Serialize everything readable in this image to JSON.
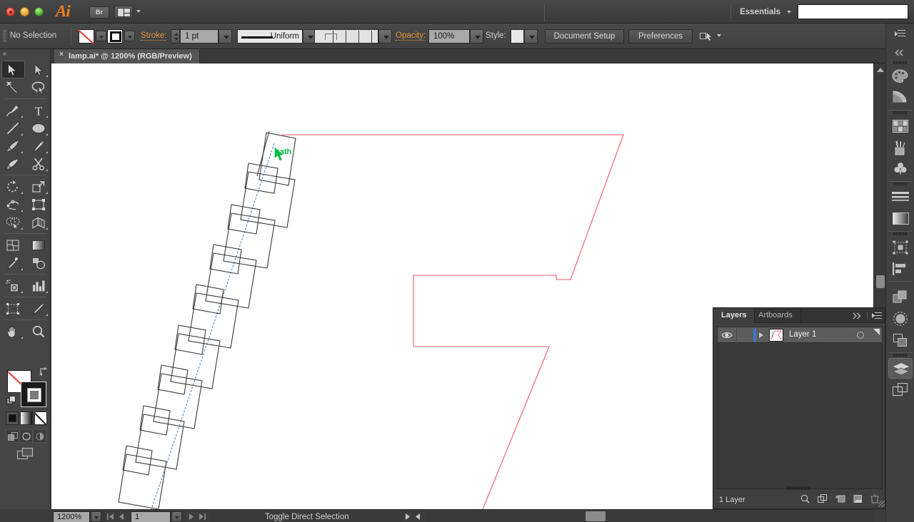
{
  "app": {
    "name": "Adobe Illustrator",
    "logo_text": "Ai",
    "bridge_label": "Br",
    "arrange_docs_name": "arrange-documents",
    "workspace": "Essentials",
    "search_placeholder": ""
  },
  "window_controls": [
    {
      "name": "close",
      "color": "#d93d2e"
    },
    {
      "name": "minimize",
      "color": "#e0a02a"
    },
    {
      "name": "zoom",
      "color": "#49a62a"
    }
  ],
  "control_bar": {
    "selection_status": "No Selection",
    "fill_label": "Fill",
    "fill_value": "None",
    "stroke_swatch_label": "Stroke color",
    "stroke_label": "Stroke:",
    "stroke_weight": "1 pt",
    "profile_label": "Uniform",
    "variable_width_label": "Variable Width Profile",
    "opacity_label": "Opacity:",
    "opacity_value": "100%",
    "style_label": "Style:",
    "document_setup": "Document Setup",
    "preferences": "Preferences",
    "snap_icon": "snap-to-grid-icon"
  },
  "document_tab": {
    "title": "lamp.ai* @ 1200% (RGB/Preview)",
    "close_label": "×"
  },
  "tools": {
    "rows": [
      [
        {
          "label": "Selection Tool",
          "icon": "selection-arrow-icon",
          "selected": true,
          "has_flyout": false
        },
        {
          "label": "Direct Selection Tool",
          "icon": "direct-selection-arrow-icon",
          "selected": false,
          "has_flyout": true
        }
      ],
      [
        {
          "label": "Magic Wand Tool",
          "icon": "magic-wand-icon",
          "selected": false,
          "has_flyout": false
        },
        {
          "label": "Lasso Tool",
          "icon": "lasso-icon",
          "selected": false,
          "has_flyout": false
        }
      ],
      [
        {
          "label": "Pen Tool",
          "icon": "pen-icon",
          "selected": false,
          "has_flyout": true
        },
        {
          "label": "Type Tool",
          "icon": "type-icon",
          "selected": false,
          "has_flyout": true
        }
      ],
      [
        {
          "label": "Line Segment Tool",
          "icon": "line-segment-icon",
          "selected": false,
          "has_flyout": true
        },
        {
          "label": "Ellipse Tool",
          "icon": "ellipse-icon",
          "selected": false,
          "has_flyout": true
        }
      ],
      [
        {
          "label": "Paintbrush Tool",
          "icon": "paintbrush-icon",
          "selected": false,
          "has_flyout": true
        },
        {
          "label": "Pencil Tool",
          "icon": "pencil-icon",
          "selected": false,
          "has_flyout": true
        }
      ],
      [
        {
          "label": "Blob Brush Tool",
          "icon": "blob-brush-icon",
          "selected": false,
          "has_flyout": false
        },
        {
          "label": "Eraser Tool",
          "icon": "scissors-icon",
          "selected": false,
          "has_flyout": true
        }
      ],
      [
        {
          "label": "Rotate Tool",
          "icon": "rotate-icon",
          "selected": false,
          "has_flyout": true
        },
        {
          "label": "Scale Tool",
          "icon": "scale-icon",
          "selected": false,
          "has_flyout": true
        }
      ],
      [
        {
          "label": "Width Tool",
          "icon": "width-warp-icon",
          "selected": false,
          "has_flyout": true
        },
        {
          "label": "Free Transform Tool",
          "icon": "free-transform-icon",
          "selected": false,
          "has_flyout": false
        }
      ],
      [
        {
          "label": "Shape Builder Tool",
          "icon": "shape-builder-icon",
          "selected": false,
          "has_flyout": true
        },
        {
          "label": "Perspective Grid Tool",
          "icon": "perspective-grid-icon",
          "selected": false,
          "has_flyout": true
        }
      ],
      [
        {
          "label": "Mesh Tool",
          "icon": "mesh-icon",
          "selected": false,
          "has_flyout": false
        },
        {
          "label": "Gradient Tool",
          "icon": "gradient-icon",
          "selected": false,
          "has_flyout": false
        }
      ],
      [
        {
          "label": "Eyedropper Tool",
          "icon": "eyedropper-icon",
          "selected": false,
          "has_flyout": true
        },
        {
          "label": "Blend Tool",
          "icon": "blend-icon",
          "selected": false,
          "has_flyout": false
        }
      ],
      [
        {
          "label": "Symbol Sprayer Tool",
          "icon": "symbol-sprayer-icon",
          "selected": false,
          "has_flyout": true
        },
        {
          "label": "Column Graph Tool",
          "icon": "column-graph-icon",
          "selected": false,
          "has_flyout": true
        }
      ],
      [
        {
          "label": "Artboard Tool",
          "icon": "artboard-icon",
          "selected": false,
          "has_flyout": false
        },
        {
          "label": "Slice Tool",
          "icon": "slice-knife-icon",
          "selected": false,
          "has_flyout": true
        }
      ],
      [
        {
          "label": "Hand Tool",
          "icon": "hand-icon",
          "selected": false,
          "has_flyout": true
        },
        {
          "label": "Zoom Tool",
          "icon": "magnifier-icon",
          "selected": false,
          "has_flyout": false
        }
      ]
    ],
    "fill_stroke": {
      "fill_name": "fill-swatch-none",
      "stroke_name": "stroke-swatch-black",
      "swap_name": "swap-fill-stroke-icon",
      "default_name": "default-fill-stroke-icon"
    },
    "color_modes": [
      {
        "name": "color-mode-button",
        "label": "Color"
      },
      {
        "name": "gradient-mode-button",
        "label": "Gradient"
      },
      {
        "name": "none-mode-button",
        "label": "None"
      }
    ],
    "draw_modes": [
      {
        "name": "draw-normal-button",
        "label": "Draw Normal"
      },
      {
        "name": "draw-behind-button",
        "label": "Draw Behind"
      },
      {
        "name": "draw-inside-button",
        "label": "Draw Inside"
      }
    ],
    "screen_mode": {
      "name": "change-screen-mode-button",
      "label": "Change Screen Mode"
    }
  },
  "layers_panel": {
    "tabs": [
      {
        "label": "Layers",
        "active": true
      },
      {
        "label": "Artboards",
        "active": false
      }
    ],
    "collapse_icon": "collapse-to-icons-icon",
    "menu_icon": "panel-menu-icon",
    "rows": [
      {
        "name": "Layer 1",
        "visible": true,
        "locked": false,
        "color": "#3b7ad0",
        "selected": true
      }
    ],
    "footer": {
      "count": "1 Layer",
      "icons": [
        {
          "name": "locate-object-icon",
          "label": "Locate Object"
        },
        {
          "name": "make-clipping-mask-icon",
          "label": "Make/Release Clipping Mask"
        },
        {
          "name": "create-new-sublayer-icon",
          "label": "Create New Sublayer"
        },
        {
          "name": "create-new-layer-icon",
          "label": "Create New Layer"
        },
        {
          "name": "delete-selection-icon",
          "label": "Delete Selection"
        }
      ]
    }
  },
  "right_dock": {
    "groups": [
      [
        {
          "name": "color-panel-icon",
          "label": "Color"
        },
        {
          "name": "color-guide-panel-icon",
          "label": "Color Guide"
        }
      ],
      [
        {
          "name": "swatches-panel-icon",
          "label": "Swatches"
        },
        {
          "name": "brushes-panel-icon",
          "label": "Brushes"
        },
        {
          "name": "symbols-panel-icon",
          "label": "Symbols"
        }
      ],
      [
        {
          "name": "stroke-panel-icon",
          "label": "Stroke"
        },
        {
          "name": "gradient-panel-icon",
          "label": "Gradient"
        }
      ],
      [
        {
          "name": "transform-panel-icon",
          "label": "Transform"
        },
        {
          "name": "align-panel-icon",
          "label": "Align"
        }
      ],
      [
        {
          "name": "pathfinder-panel-icon",
          "label": "Pathfinder"
        },
        {
          "name": "transparency-panel-icon",
          "label": "Transparency"
        },
        {
          "name": "appearance-panel-icon",
          "label": "Appearance"
        }
      ],
      [
        {
          "name": "layers-panel-icon",
          "label": "Layers",
          "active": true
        },
        {
          "name": "artboards-panel-icon",
          "label": "Artboards"
        }
      ]
    ]
  },
  "status_bar": {
    "zoom_level": "1200%",
    "page_number": "1",
    "status_text": "Toggle Direct Selection",
    "first_page_icon": "first-page-icon",
    "prev_page_icon": "previous-page-icon",
    "next_page_icon": "next-page-icon",
    "last_page_icon": "last-page-icon",
    "status_menu_icon": "status-menu-arrow-icon",
    "scroll_left_icon": "scroll-left-arrow-icon"
  },
  "canvas": {
    "smart_guide_label": "path",
    "smart_guide_color": "#00c040",
    "path_color": "#3b7ad0",
    "shape_outline_color": "#f4566a",
    "brush_square_color": "#333333",
    "background": "#ffffff",
    "zoom": "1200%"
  }
}
